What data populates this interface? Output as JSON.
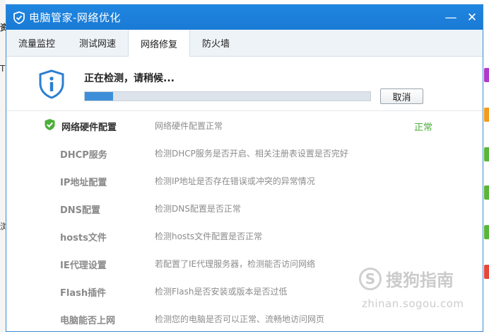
{
  "window": {
    "title": "电脑管家-网络优化",
    "minimize_label": "—",
    "close_label": "✕"
  },
  "tabs": [
    {
      "label": "流量监控",
      "active": false
    },
    {
      "label": "测试网速",
      "active": false
    },
    {
      "label": "网络修复",
      "active": true
    },
    {
      "label": "防火墙",
      "active": false
    }
  ],
  "status": {
    "text": "正在检测，请稍候...",
    "progress_fraction": 0.1,
    "cancel_label": "取消"
  },
  "checks": [
    {
      "name": "网络硬件配置",
      "description": "网络硬件配置正常",
      "status": "正常",
      "done": true
    },
    {
      "name": "DHCP服务",
      "description": "检测DHCP服务是否开启、相关注册表设置是否完好",
      "status": "",
      "done": false
    },
    {
      "name": "IP地址配置",
      "description": "检测IP地址是否存在错误或冲突的异常情况",
      "status": "",
      "done": false
    },
    {
      "name": "DNS配置",
      "description": "检测DNS配置是否正常",
      "status": "",
      "done": false
    },
    {
      "name": "hosts文件",
      "description": "检测hosts文件配置是否正常",
      "status": "",
      "done": false
    },
    {
      "name": "IE代理设置",
      "description": "若配置了IE代理服务器，检测能否访问网络",
      "status": "",
      "done": false
    },
    {
      "name": "Flash插件",
      "description": "检测Flash是否安装或版本是否过低",
      "status": "",
      "done": false
    },
    {
      "name": "电脑能否上网",
      "description": "检测您的电脑是否可以正常、流畅地访问网页",
      "status": "",
      "done": false
    }
  ],
  "watermark": {
    "logo_letter": "S",
    "text": "搜狗指南",
    "url": "zhinan.sogou.com"
  },
  "background": {
    "left_fragments": [
      "资",
      "T",
      "浏"
    ]
  },
  "colors": {
    "titlebar": "#1a7ad5",
    "progress": "#3d8fd9",
    "ok_green": "#4caf3a"
  }
}
